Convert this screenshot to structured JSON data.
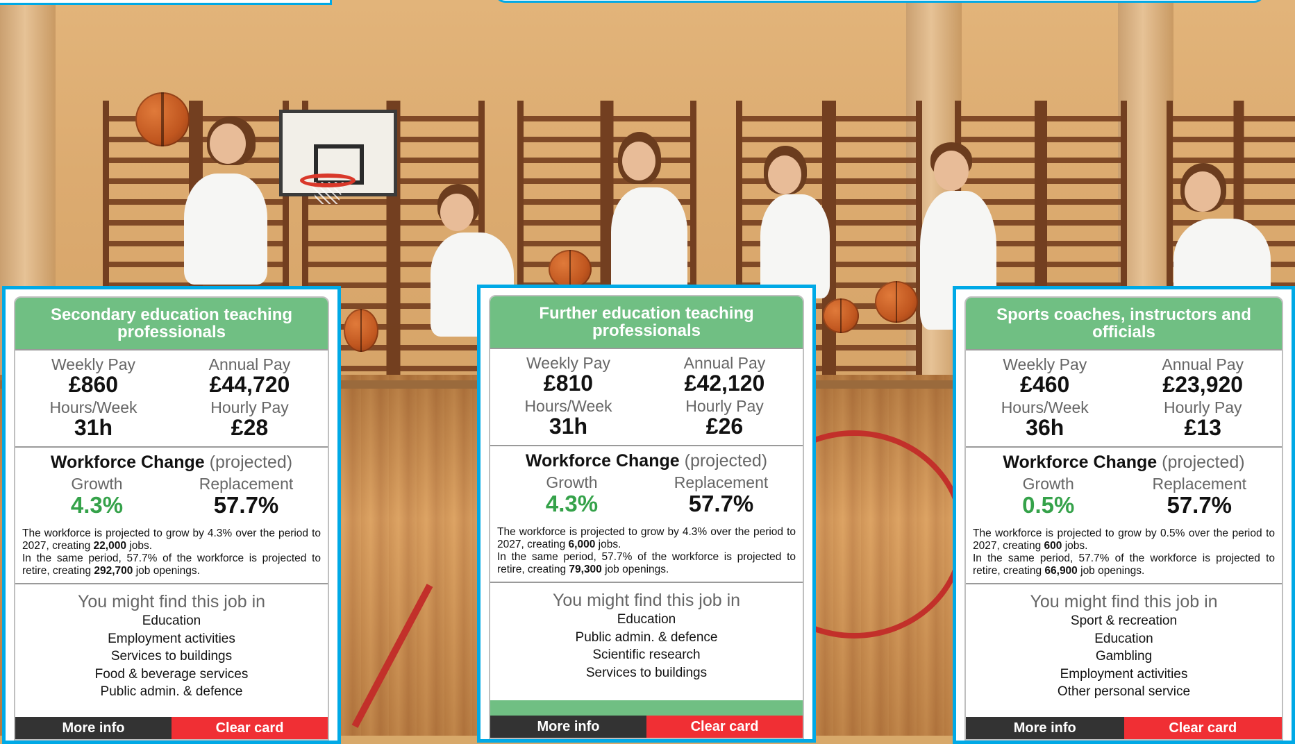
{
  "colors": {
    "accent_border": "#00a9e6",
    "card_header": "#70bf83",
    "growth_green": "#35a24a",
    "more_info_bg": "#333333",
    "clear_card_bg": "#f02f34"
  },
  "icons": [
    "background-photo-gym"
  ],
  "cards": [
    {
      "title": "Secondary education teaching professionals",
      "weekly_pay_label": "Weekly Pay",
      "weekly_pay": "£860",
      "annual_pay_label": "Annual Pay",
      "annual_pay": "£44,720",
      "hours_label": "Hours/Week",
      "hours": "31h",
      "hourly_pay_label": "Hourly Pay",
      "hourly_pay": "£28",
      "workforce_heading": "Workforce Change",
      "workforce_sub": "(projected)",
      "growth_label": "Growth",
      "growth": "4.3%",
      "replacement_label": "Replacement",
      "replacement": "57.7%",
      "growth_text_a": "The workforce is projected to grow by 4.3% over the period to 2027, creating ",
      "growth_jobs": "22,000",
      "growth_text_b": " jobs.",
      "retire_text_a": "In the same period, 57.7% of the workforce is projected to retire, creating ",
      "retire_jobs": "292,700",
      "retire_text_b": " job openings.",
      "industries_heading": "You might find this job in",
      "industries": [
        "Education",
        "Employment activities",
        "Services to buildings",
        "Food & beverage services",
        "Public admin. & defence"
      ],
      "more_info_label": "More info",
      "clear_card_label": "Clear card"
    },
    {
      "title": "Further education teaching professionals",
      "weekly_pay_label": "Weekly Pay",
      "weekly_pay": "£810",
      "annual_pay_label": "Annual Pay",
      "annual_pay": "£42,120",
      "hours_label": "Hours/Week",
      "hours": "31h",
      "hourly_pay_label": "Hourly Pay",
      "hourly_pay": "£26",
      "workforce_heading": "Workforce Change",
      "workforce_sub": "(projected)",
      "growth_label": "Growth",
      "growth": "4.3%",
      "replacement_label": "Replacement",
      "replacement": "57.7%",
      "growth_text_a": "The workforce is projected to grow by 4.3% over the period to 2027, creating ",
      "growth_jobs": "6,000",
      "growth_text_b": " jobs.",
      "retire_text_a": "In the same period, 57.7% of the workforce is projected to retire, creating ",
      "retire_jobs": "79,300",
      "retire_text_b": " job openings.",
      "industries_heading": "You might find this job in",
      "industries": [
        "Education",
        "Public admin. & defence",
        "Scientific research",
        "Services to buildings"
      ],
      "more_info_label": "More info",
      "clear_card_label": "Clear card"
    },
    {
      "title": "Sports coaches, instructors and officials",
      "weekly_pay_label": "Weekly Pay",
      "weekly_pay": "£460",
      "annual_pay_label": "Annual Pay",
      "annual_pay": "£23,920",
      "hours_label": "Hours/Week",
      "hours": "36h",
      "hourly_pay_label": "Hourly Pay",
      "hourly_pay": "£13",
      "workforce_heading": "Workforce Change",
      "workforce_sub": "(projected)",
      "growth_label": "Growth",
      "growth": "0.5%",
      "replacement_label": "Replacement",
      "replacement": "57.7%",
      "growth_text_a": "The workforce is projected to grow by 0.5% over the period to 2027, creating ",
      "growth_jobs": "600",
      "growth_text_b": " jobs.",
      "retire_text_a": "In the same period, 57.7% of the workforce is projected to retire, creating ",
      "retire_jobs": "66,900",
      "retire_text_b": " job openings.",
      "industries_heading": "You might find this job in",
      "industries": [
        "Sport & recreation",
        "Education",
        "Gambling",
        "Employment activities",
        "Other personal service"
      ],
      "more_info_label": "More info",
      "clear_card_label": "Clear card"
    }
  ]
}
